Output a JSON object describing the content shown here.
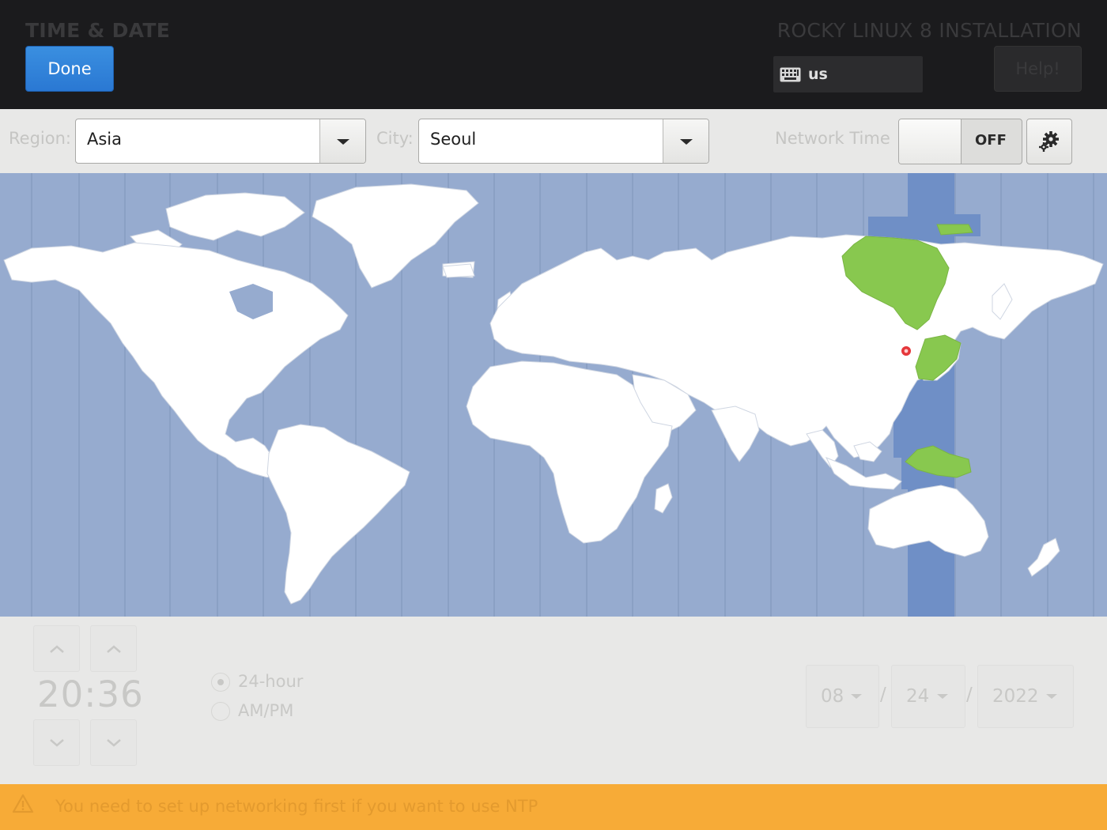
{
  "header": {
    "title": "TIME & DATE",
    "done_label": "Done",
    "product": "ROCKY LINUX 8 INSTALLATION",
    "keyboard_layout": "us",
    "help_label": "Help!"
  },
  "toolbar": {
    "region_label": "Region:",
    "region_value": "Asia",
    "city_label": "City:",
    "city_value": "Seoul",
    "network_time_label": "Network Time",
    "network_time_state": "OFF"
  },
  "map": {
    "selected_timezone": "Asia/Seoul",
    "colors": {
      "ocean": "#96abcf",
      "highlight_band": "#6f8fc6",
      "selected_region": "#88c84f",
      "land": "#ffffff",
      "pin": "#e5373b"
    }
  },
  "time": {
    "hours": "20",
    "separator": ":",
    "minutes": "36",
    "format_24": "24-hour",
    "format_ampm": "AM/PM",
    "selected_format": "24-hour"
  },
  "date": {
    "month": "08",
    "day": "24",
    "year": "2022",
    "separator": "/"
  },
  "warning": {
    "message": "You need to set up networking first if you want to use NTP"
  },
  "icons": {
    "keyboard": "keyboard-icon",
    "gear": "gear-icon",
    "warning": "warning-icon",
    "pin": "map-pin-icon"
  }
}
